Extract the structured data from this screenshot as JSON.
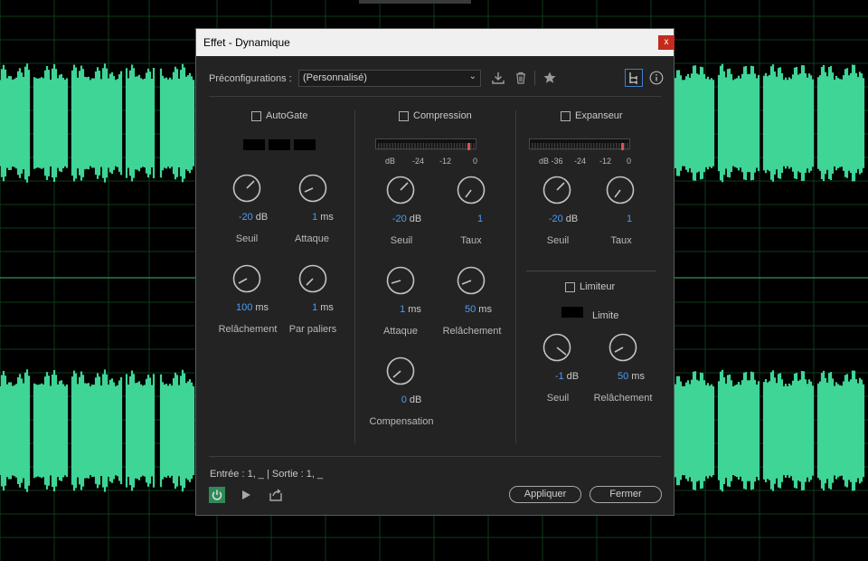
{
  "dialog": {
    "title": "Effet - Dynamique",
    "close_glyph": "x"
  },
  "presets": {
    "label": "Préconfigurations :",
    "value": "(Personnalisé)"
  },
  "icons": [
    "download-icon",
    "trash-icon",
    "star-icon",
    "routing-icon",
    "info-icon",
    "power-icon",
    "play-icon",
    "export-icon"
  ],
  "autogate": {
    "title": "AutoGate",
    "seuil": {
      "value": "-20",
      "unit": "dB",
      "label": "Seuil"
    },
    "attaque": {
      "value": "1",
      "unit": "ms",
      "label": "Attaque"
    },
    "relachement": {
      "value": "100",
      "unit": "ms",
      "label": "Relâchement"
    },
    "paliers": {
      "value": "1",
      "unit": "ms",
      "label": "Par paliers"
    }
  },
  "compression": {
    "title": "Compression",
    "scale": [
      "dB",
      "-24",
      "-12",
      "0"
    ],
    "seuil": {
      "value": "-20",
      "unit": "dB",
      "label": "Seuil"
    },
    "taux": {
      "value": "1",
      "label": "Taux"
    },
    "attaque": {
      "value": "1",
      "unit": "ms",
      "label": "Attaque"
    },
    "relachement": {
      "value": "50",
      "unit": "ms",
      "label": "Relâchement"
    },
    "compensation": {
      "value": "0",
      "unit": "dB",
      "label": "Compensation"
    }
  },
  "expanseur": {
    "title": "Expanseur",
    "scale": [
      "dB -36",
      "-24",
      "-12",
      "0"
    ],
    "seuil": {
      "value": "-20",
      "unit": "dB",
      "label": "Seuil"
    },
    "taux": {
      "value": "1",
      "label": "Taux"
    }
  },
  "limiteur": {
    "title": "Limiteur",
    "limite_label": "Limite",
    "seuil": {
      "value": "-1",
      "unit": "dB",
      "label": "Seuil"
    },
    "relachement": {
      "value": "50",
      "unit": "ms",
      "label": "Relâchement"
    }
  },
  "footer": {
    "io": "Entrée : 1, _ | Sortie : 1, _",
    "apply": "Appliquer",
    "close": "Fermer"
  },
  "colors": {
    "accent": "#4a9df8",
    "waveform": "#3ed597",
    "power": "#2e8b57",
    "meter_peak": "#e05050"
  }
}
